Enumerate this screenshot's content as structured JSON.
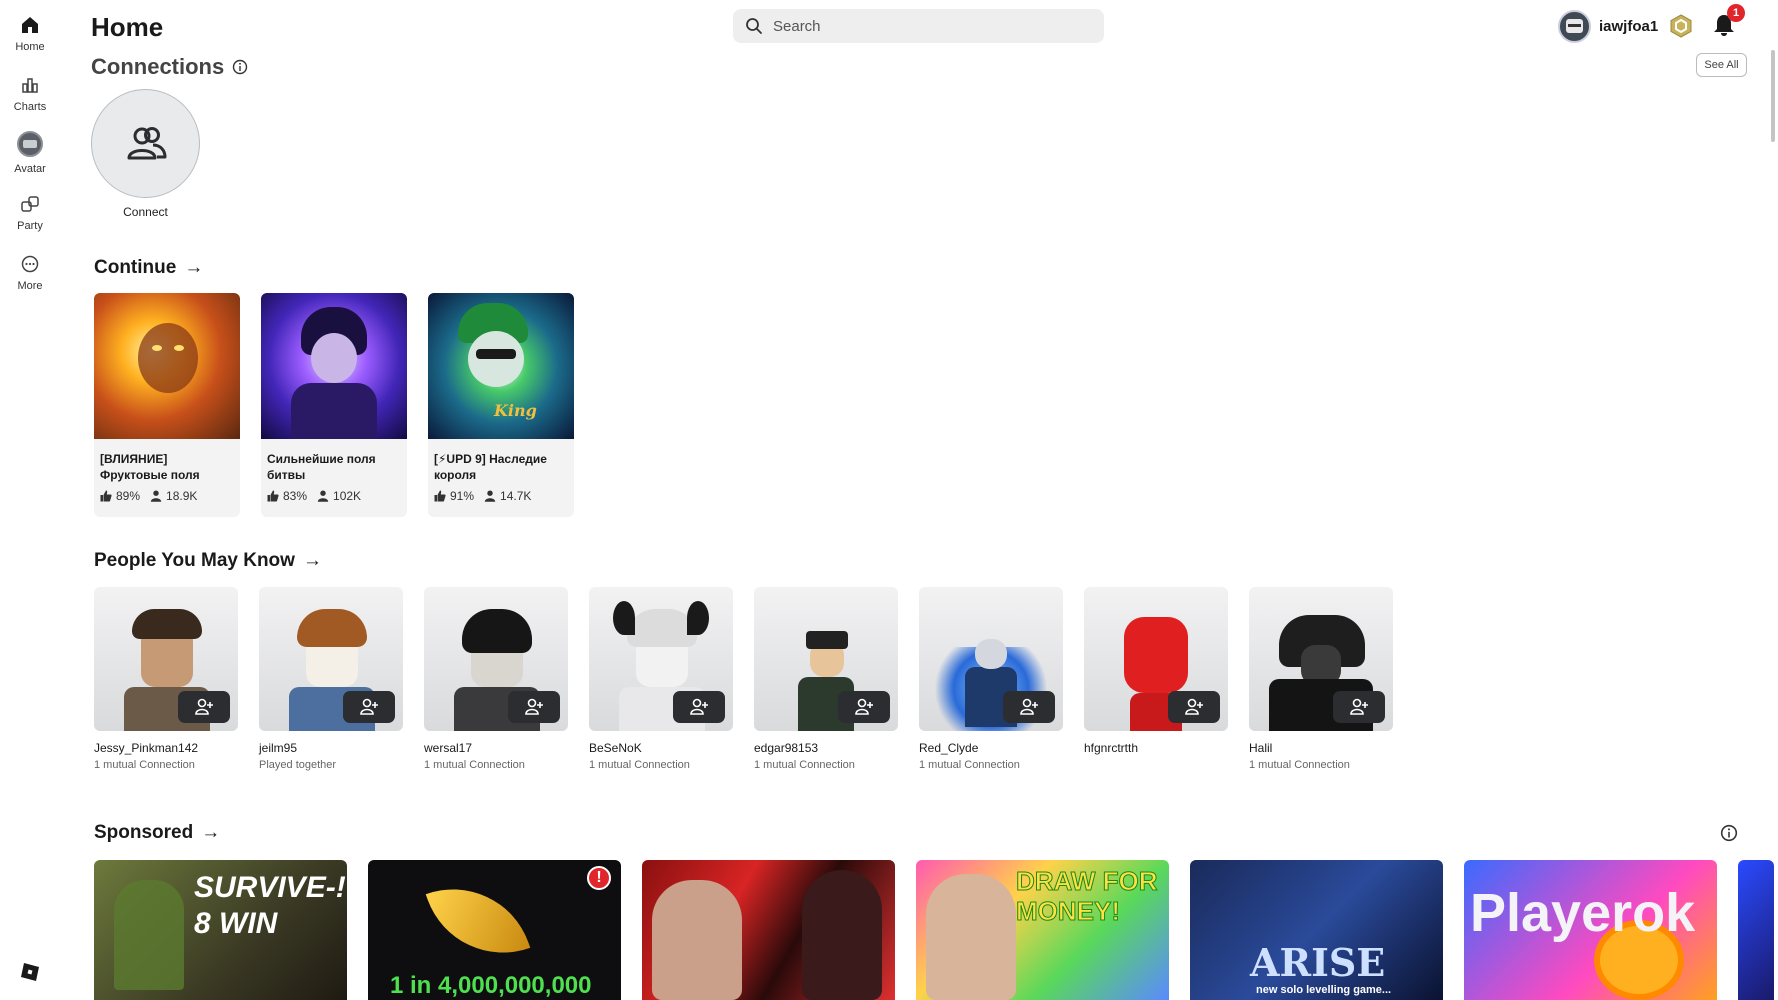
{
  "sidebar": {
    "items": [
      {
        "label": "Home"
      },
      {
        "label": "Charts"
      },
      {
        "label": "Avatar"
      },
      {
        "label": "Party"
      },
      {
        "label": "More"
      }
    ]
  },
  "header": {
    "title": "Home",
    "search_placeholder": "Search",
    "username": "iawjfoa1",
    "notification_count": "1"
  },
  "connections": {
    "title": "Connections",
    "see_all": "See All",
    "connect_label": "Connect"
  },
  "continue": {
    "title": "Continue",
    "games": [
      {
        "name": "[ВЛИЯНИЕ] Фруктовые поля битвы",
        "rating": "89%",
        "players": "18.9K"
      },
      {
        "name": "Сильнейшие поля битвы",
        "rating": "83%",
        "players": "102K"
      },
      {
        "name": "[⚡UPD 9] Наследие короля",
        "rating": "91%",
        "players": "14.7K"
      }
    ]
  },
  "people": {
    "title": "People You May Know",
    "list": [
      {
        "name": "Jessy_Pinkman142",
        "sub": "1 mutual Connection"
      },
      {
        "name": "jeilm95",
        "sub": "Played together"
      },
      {
        "name": "wersal17",
        "sub": "1 mutual Connection"
      },
      {
        "name": "BeSeNoK",
        "sub": "1 mutual Connection"
      },
      {
        "name": "edgar98153",
        "sub": "1 mutual Connection"
      },
      {
        "name": "Red_Clyde",
        "sub": "1 mutual Connection"
      },
      {
        "name": "hfgnrctrtth",
        "sub": ""
      },
      {
        "name": "Halil",
        "sub": "1 mutual Connection"
      }
    ]
  },
  "sponsored": {
    "title": "Sponsored",
    "ads": [
      {
        "text": "SURVIVE-! 8 WIN"
      },
      {
        "text": "1 in 4,000,000,000"
      },
      {
        "text": ""
      },
      {
        "text": "DRAW FOR MONEY!"
      },
      {
        "text": "ARISE",
        "subtext": "new solo levelling game..."
      },
      {
        "text": "Playerok"
      }
    ]
  },
  "colors": {
    "accent_dark": "#2b2d30",
    "badge_red": "#e0262b",
    "search_bg": "#eeeeef"
  }
}
